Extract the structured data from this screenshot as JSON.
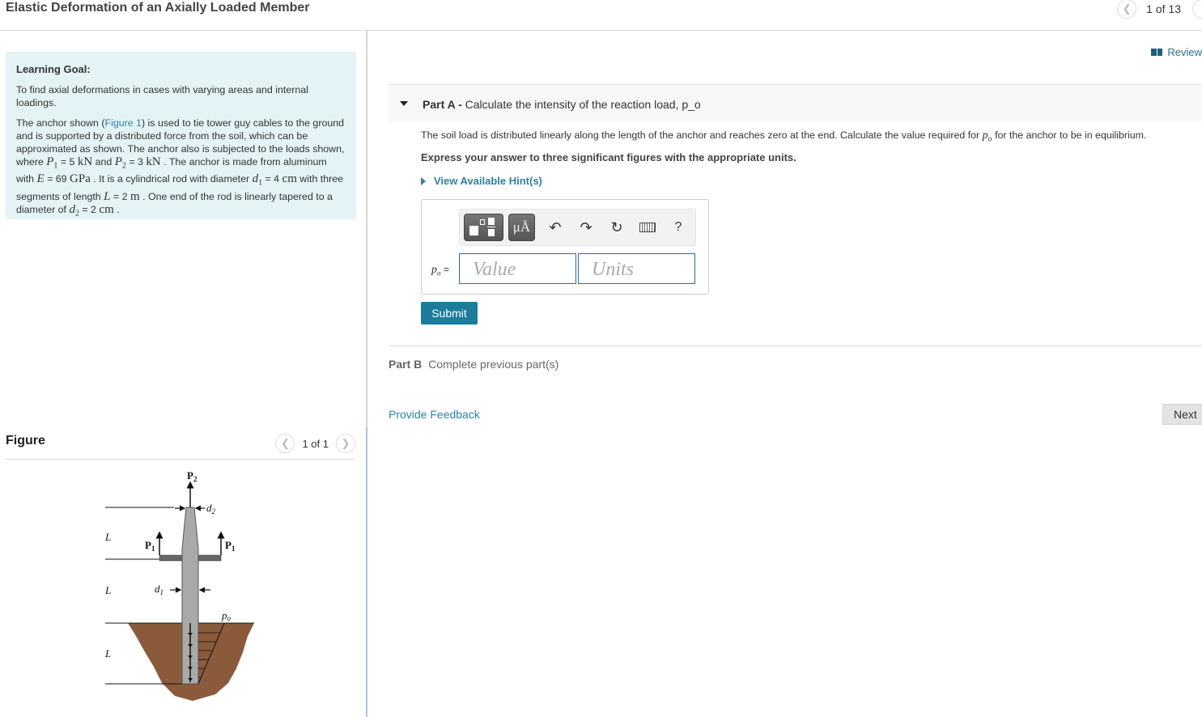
{
  "header": {
    "title": "Elastic Deformation of an Axially Loaded Member",
    "pager": {
      "current": "1 of 13",
      "prev_icon": "chevron-left-icon",
      "next_icon": "chevron-right-icon"
    }
  },
  "learning_goal": {
    "title": "Learning Goal:",
    "goal_text": "To find axial deformations in cases with varying areas and internal loadings.",
    "body": {
      "t1": "The anchor shown (",
      "figure_link": "Figure 1",
      "t2": ") is used to tie tower guy cables to the ground and is supported by a distributed force from the soil, which can be approximated as shown. The anchor also is subjected to the loads shown, where ",
      "p1_sym": "P",
      "p1_sub": "1",
      "p1_val": " = 5 ",
      "p1_unit": "kN",
      "t3": " and ",
      "p2_sym": "P",
      "p2_sub": "2",
      "p2_val": " = 3 ",
      "p2_unit": "kN",
      "t4": " . The anchor is made from aluminum with ",
      "e_sym": "E",
      "e_val": " = 69 ",
      "e_unit": "GPa",
      "t5": " . It is a cylindrical rod with diameter ",
      "d1_sym": "d",
      "d1_sub": "1",
      "d1_val": " = 4 ",
      "d1_unit": "cm",
      "t6": " with three segments of length ",
      "l_sym": "L",
      "l_val": " = 2 ",
      "l_unit": "m",
      "t7": " . One end of the rod is linearly tapered to a diameter of ",
      "d2_sym": "d",
      "d2_sub": "2",
      "d2_val": " = 2 ",
      "d2_unit": "cm",
      "t8": " ."
    }
  },
  "figure": {
    "title": "Figure",
    "pager": "1 of 1",
    "labels": {
      "P2": "P",
      "P2_sub": "2",
      "P1": "P",
      "P1_sub": "1",
      "d2": "d",
      "d2_sub": "2",
      "d1": "d",
      "d1_sub": "1",
      "L": "L",
      "po": "p",
      "po_sub": "o"
    }
  },
  "review_link": "Review",
  "part_a": {
    "label": "Part A -",
    "title": "Calculate the intensity of the reaction load, p_o",
    "question_pre": "The soil load is distributed linearly along the length of the anchor and reaches zero at the end. Calculate the value required for ",
    "question_sym": "p",
    "question_sub": "o",
    "question_post": " for the anchor to be in equilibrium.",
    "instruction": "Express your answer to three significant figures with the appropriate units.",
    "hints_label": "View Available Hint(s)",
    "toolbar": {
      "templates_icon": "templates-icon",
      "units_label": "μÅ",
      "undo_icon": "↶",
      "redo_icon": "↷",
      "reset_icon": "↻",
      "keyboard_icon": "keyboard-icon",
      "help_label": "?"
    },
    "variable": "p",
    "variable_sub": "o",
    "equals": " =",
    "value_placeholder": "Value",
    "units_placeholder": "Units",
    "value": "",
    "units": "",
    "submit_label": "Submit"
  },
  "part_b": {
    "label": "Part B",
    "status": "Complete previous part(s)"
  },
  "feedback_link": "Provide Feedback",
  "next_label": "Next ❯"
}
